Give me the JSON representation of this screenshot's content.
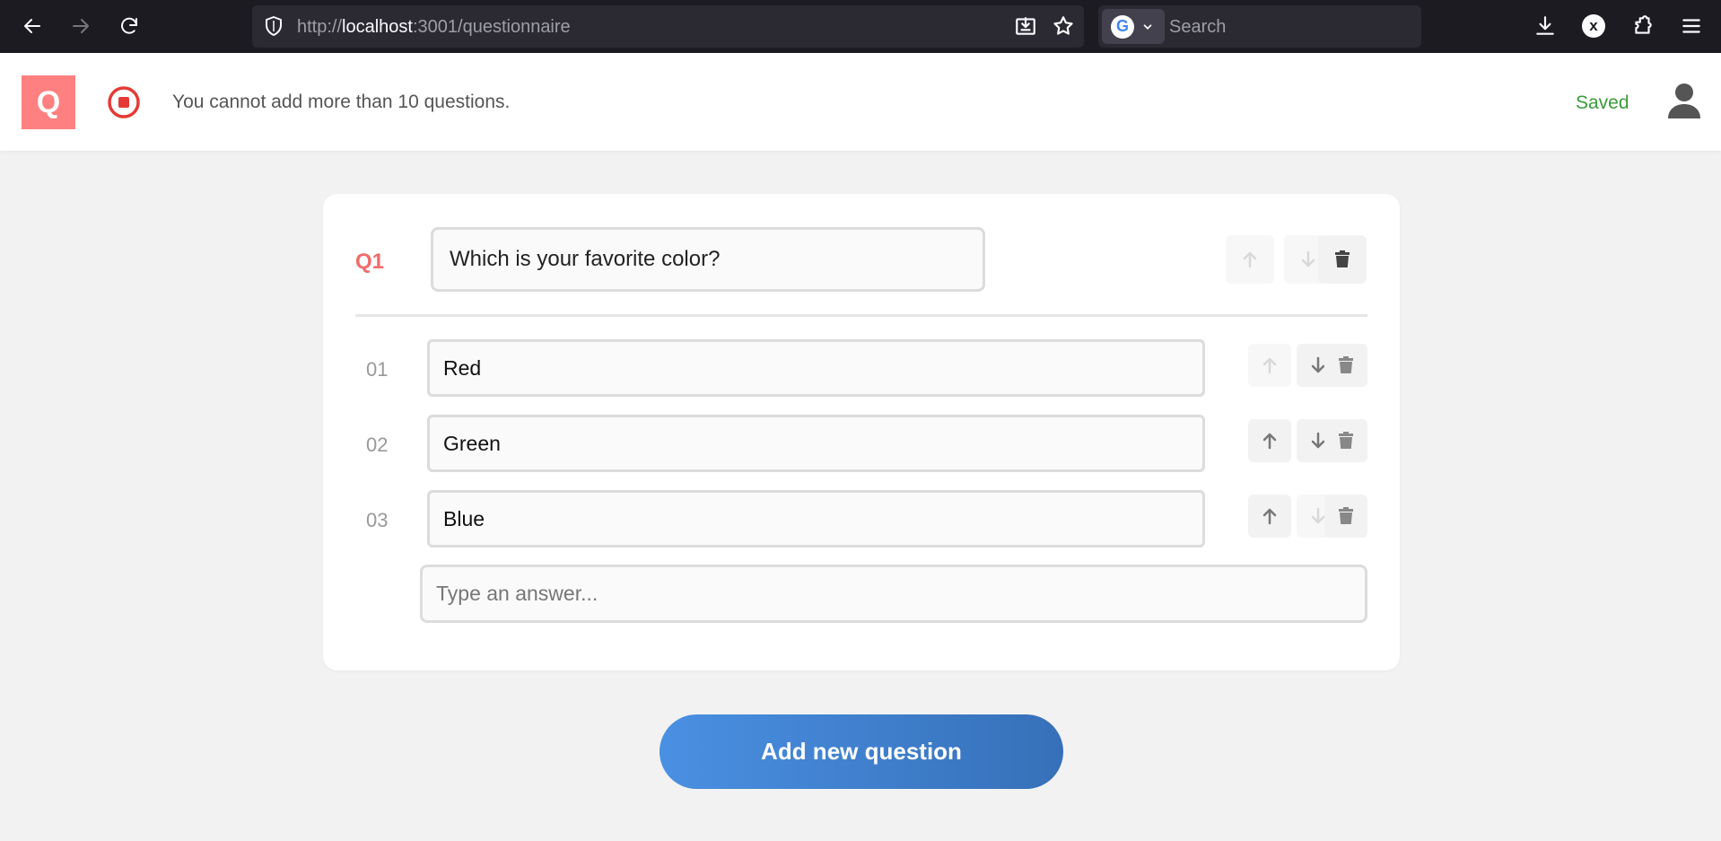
{
  "browser": {
    "url_prefix": "http://",
    "url_host": "localhost",
    "url_path": ":3001/questionnaire",
    "search_placeholder": "Search",
    "extension_letter": "x"
  },
  "header": {
    "logo_letter": "Q",
    "error_message": "You cannot add more than 10 questions.",
    "saved_status": "Saved",
    "accent_color": "#ff8080",
    "error_color": "#e53935",
    "saved_color": "#3a9b3a"
  },
  "question": {
    "label": "Q1",
    "text": "Which is your favorite color?",
    "answers": [
      {
        "num": "01",
        "text": "Red",
        "up_enabled": false,
        "down_enabled": true
      },
      {
        "num": "02",
        "text": "Green",
        "up_enabled": true,
        "down_enabled": true
      },
      {
        "num": "03",
        "text": "Blue",
        "up_enabled": true,
        "down_enabled": false
      }
    ],
    "new_answer_placeholder": "Type an answer..."
  },
  "actions": {
    "add_question_label": "Add new question"
  },
  "icons": {
    "back": "arrow-left-icon",
    "forward": "arrow-right-icon",
    "reload": "reload-icon",
    "shield": "shield-icon",
    "save_page": "save-page-icon",
    "bookmark": "star-icon",
    "download": "download-icon",
    "extensions": "puzzle-icon",
    "menu": "hamburger-icon",
    "error": "stop-circle-icon",
    "user": "user-icon",
    "move_up": "arrow-up-icon",
    "move_down": "arrow-down-icon",
    "delete": "trash-icon"
  }
}
